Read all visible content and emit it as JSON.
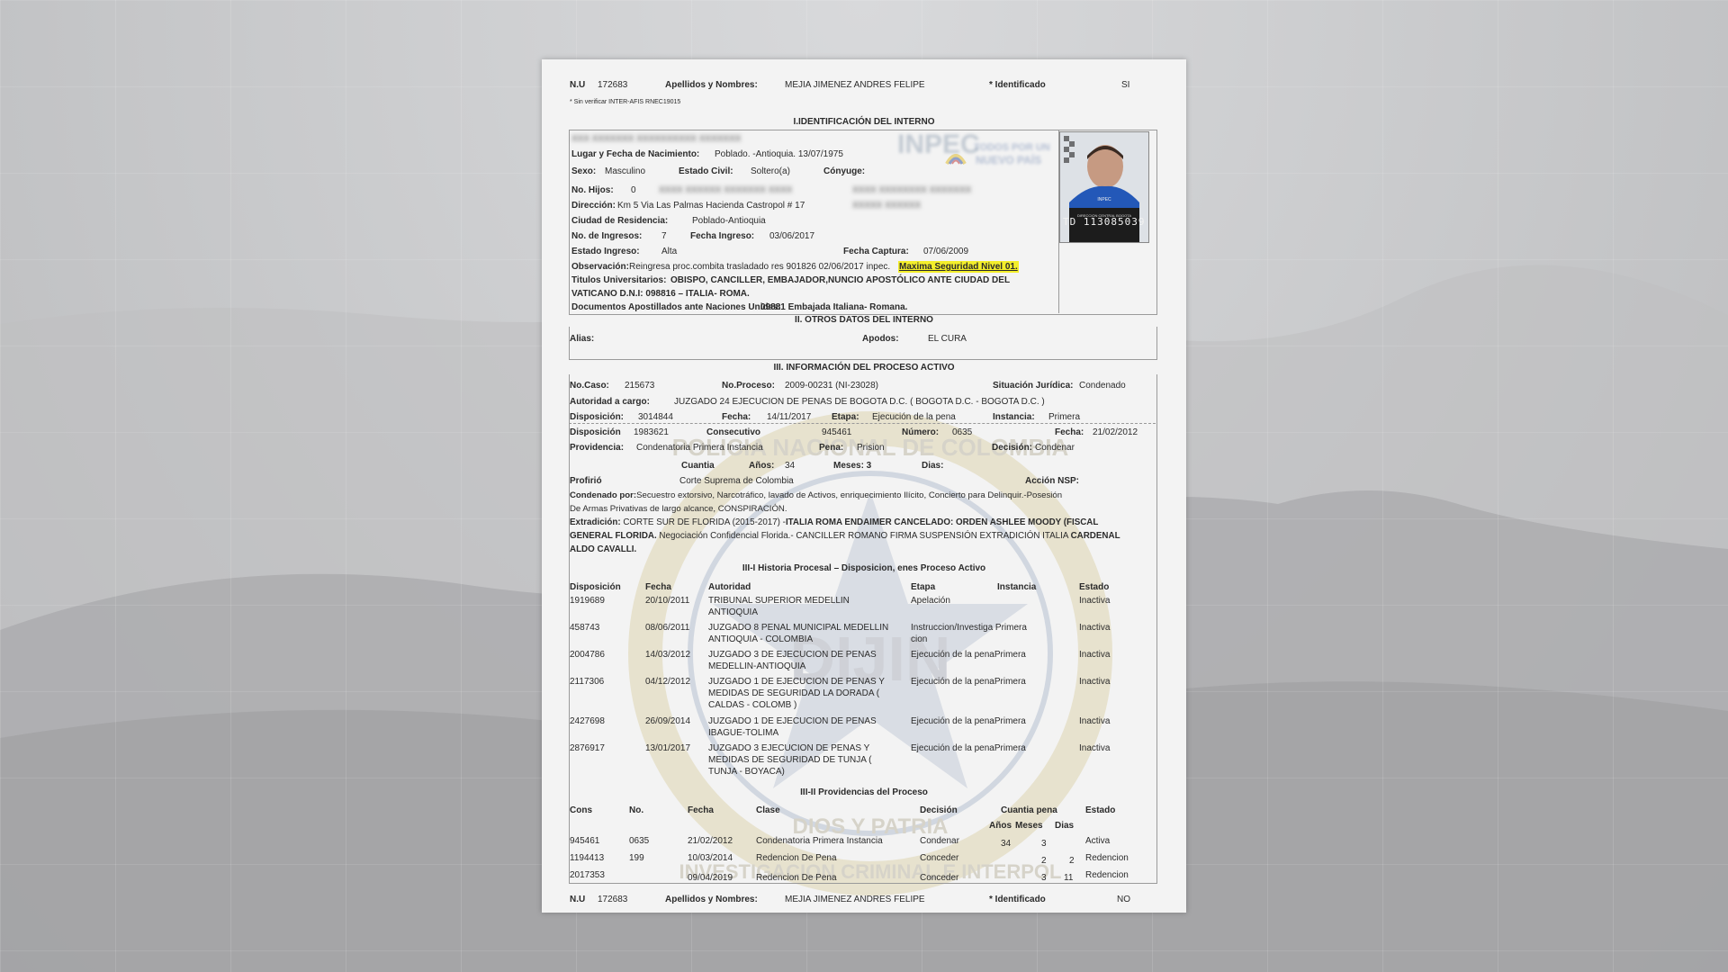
{
  "header": {
    "nu_label": "N.U",
    "nu_value": "172683",
    "nombres_label": "Apellidos y Nombres:",
    "nombres_value": "MEJIA JIMENEZ ANDRES FELIPE",
    "identificado_label": "* Identificado",
    "identificado_value": "SI",
    "note": "* Sin verificar INTER-AFIS RNEC19015"
  },
  "section1": {
    "title": "I.IDENTIFICACIÓN DEL INTERNO",
    "nacimiento_label": "Lugar y Fecha de Nacimiento:",
    "nacimiento_value": "Poblado. -Antioquia. 13/07/1975",
    "sexo_label": "Sexo:",
    "sexo_value": "Masculino",
    "estado_civil_label": "Estado Civil:",
    "estado_civil_value": "Soltero(a)",
    "conyuge_label": "Cónyuge:",
    "hijos_label": "No. Hijos:",
    "hijos_value": "0",
    "direccion_label": "Dirección:",
    "direccion_value": "Km 5 Via Las Palmas Hacienda Castropol # 17",
    "ciudad_label": "Ciudad de Residencia:",
    "ciudad_value": "Poblado-Antioquia",
    "ingresos_label": "No. de Ingresos:",
    "ingresos_value": "7",
    "fecha_ingreso_label": "Fecha Ingreso:",
    "fecha_ingreso_value": "03/06/2017",
    "estado_ingreso_label": "Estado Ingreso:",
    "estado_ingreso_value": "Alta",
    "fecha_captura_label": "Fecha Captura:",
    "fecha_captura_value": "07/06/2009",
    "observacion_label": "Observación:",
    "observacion_value": "Reingresa proc.combita trasladado res 901826 02/06/2017 inpec.",
    "observacion_highlight": "Maxima Seguridad Nivel 01.",
    "titulos_label": "Titulos Universitarios:",
    "titulos_value_1": "OBISPO, CANCILLER, EMBAJADOR,NUNCIO APOSTÓLICO ANTE CIUDAD DEL",
    "titulos_value_2": "VATICANO D.N.I: 098816 – ITALIA- ROMA.",
    "documentos_label": "Documentos Apostillados ante Naciones Unidas:",
    "documentos_value": "09881 Embajada Italiana- Romana.",
    "logo_text_1": "TODOS POR UN",
    "logo_text_2": "NUEVO PAÍS",
    "logo_inpec": "INPEC",
    "photo_sign_1": "INPEC",
    "photo_sign_2": "DIRECCION CENTRAL BOGOTA",
    "photo_id": "TD 113085039"
  },
  "section2": {
    "title": "II. OTROS DATOS DEL INTERNO",
    "alias_label": "Alias:",
    "apodos_label": "Apodos:",
    "apodos_value": "EL CURA"
  },
  "section3": {
    "title": "III. INFORMACIÓN DEL PROCESO ACTIVO",
    "caso_label": "No.Caso:",
    "caso_value": "215673",
    "proceso_label": "No.Proceso:",
    "proceso_value": "2009-00231 (NI-23028)",
    "situacion_label": "Situación Jurídica:",
    "situacion_value": "Condenado",
    "autoridad_label": "Autoridad a cargo:",
    "autoridad_value": "JUZGADO 24 EJECUCION DE PENAS DE BOGOTA D.C. ( BOGOTA D.C. - BOGOTA D.C. )",
    "disposicion_label": "Disposición:",
    "disposicion_value": "3014844",
    "fecha_label": "Fecha:",
    "fecha_value": "14/11/2017",
    "etapa_label": "Etapa:",
    "etapa_value": "Ejecución de la pena",
    "instancia_label": "Instancia:",
    "instancia_value": "Primera",
    "disposicion2_label": "Disposición",
    "disposicion2_value": "1983621",
    "consecutivo_label": "Consecutivo",
    "consecutivo_value": "945461",
    "numero_label": "Número:",
    "numero_value": "0635",
    "fecha2_label": "Fecha:",
    "fecha2_value": "21/02/2012",
    "providencia_label": "Providencia:",
    "providencia_value": "Condenatoria Primera Instancia",
    "pena_label": "Pena:",
    "pena_value": "Prision",
    "decision_label": "Decisión:",
    "decision_value": "Condenar",
    "cuantia_label": "Cuantia",
    "anos_label": "Años:",
    "anos_value": "34",
    "meses_label": "Meses: 3",
    "dias_label": "Dias:",
    "profirio_label": "Profirió",
    "profirio_value": "Corte Suprema de Colombia",
    "accion_label": "Acción NSP:",
    "condenado_label": "Condenado por:",
    "condenado_value_1": "Secuestro extorsivo, Narcotráfico, lavado de Activos, enriquecimiento Ilícito, Concierto para Delinquir.-Posesión",
    "condenado_value_2": "De Armas Privativas de largo alcance, CONSPIRACIÓN.",
    "extradicion_label": "Extradición:",
    "extradicion_value_1": "CORTE SUR DE FLORIDA (2015-2017) -",
    "extradicion_bold_1": "ITALIA ROMA ENDAIMER CANCELADO: ORDEN  ASHLEE  MOODY (FISCAL",
    "extradicion_bold_2": "GENERAL FLORIDA.",
    "extradicion_value_2": " Negociación Confidencial Florida.-  CANCILLER ROMANO FIRMA SUSPENSIÓN EXTRADICIÓN ITALIA ",
    "extradicion_bold_3": "CARDENAL",
    "extradicion_bold_4": "ALDO CAVALLI."
  },
  "historia": {
    "title": "III-I Historia Procesal – Disposicion, enes Proceso Activo",
    "headers": [
      "Disposición",
      "Fecha",
      "Autoridad",
      "Etapa",
      "Instancia",
      "Estado"
    ],
    "rows": [
      {
        "disp": "1919689",
        "fecha": "20/10/2011",
        "aut1": "TRIBUNAL SUPERIOR MEDELLIN",
        "aut2": "ANTIOQUIA",
        "aut3": "",
        "etapa1": "Apelación",
        "etapa2": "",
        "instancia": "",
        "estado": "Inactiva"
      },
      {
        "disp": "458743",
        "fecha": "08/06/2011",
        "aut1": "JUZGADO 8 PENAL MUNICIPAL MEDELLIN",
        "aut2": "ANTIOQUIA - COLOMBIA",
        "aut3": "",
        "etapa1": "Instruccion/Investiga Primera",
        "etapa2": "cion",
        "instancia": "",
        "estado": "Inactiva"
      },
      {
        "disp": "2004786",
        "fecha": "14/03/2012",
        "aut1": "JUZGADO 3 DE EJECUCION DE PENAS",
        "aut2": "MEDELLIN-ANTIOQUIA",
        "aut3": "",
        "etapa1": "Ejecución de la penaPrimera",
        "etapa2": "",
        "instancia": "",
        "estado": "Inactiva"
      },
      {
        "disp": "2117306",
        "fecha": "04/12/2012",
        "aut1": "JUZGADO 1 DE EJECUCION DE PENAS Y",
        "aut2": "MEDIDAS DE SEGURIDAD LA  DORADA (",
        "aut3": "CALDAS - COLOMB )",
        "etapa1": "Ejecución de la penaPrimera",
        "etapa2": "",
        "instancia": "",
        "estado": "Inactiva"
      },
      {
        "disp": "2427698",
        "fecha": "26/09/2014",
        "aut1": "JUZGADO 1 DE EJECUCION DE PENAS",
        "aut2": "IBAGUE-TOLIMA",
        "aut3": "",
        "etapa1": "Ejecución de la penaPrimera",
        "etapa2": "",
        "instancia": "",
        "estado": "Inactiva"
      },
      {
        "disp": "2876917",
        "fecha": "13/01/2017",
        "aut1": "JUZGADO  3 EJECUCION DE PENAS Y",
        "aut2": "MEDIDAS DE SEGURIDAD  DE TUNJA (",
        "aut3": "TUNJA - BOYACA)",
        "etapa1": "Ejecución de la penaPrimera",
        "etapa2": "",
        "instancia": "",
        "estado": "Inactiva"
      }
    ]
  },
  "providencias": {
    "title": "III-II Providencias del Proceso",
    "headers": [
      "Cons",
      "No.",
      "Fecha",
      "Clase",
      "Decisión",
      "Cuantia pena",
      "Estado"
    ],
    "subheaders": [
      "Años",
      "Meses",
      "Dias"
    ],
    "rows": [
      {
        "cons": "945461",
        "no": "0635",
        "fecha": "21/02/2012",
        "clase": "Condenatoria Primera Instancia",
        "decision": "Condenar",
        "anos": "34",
        "meses": "3",
        "dias": "",
        "estado": "Activa"
      },
      {
        "cons": "1194413",
        "no": "199",
        "fecha": "10/03/2014",
        "clase": "Redencion De Pena",
        "decision": "Conceder",
        "anos": "",
        "meses": "2",
        "dias": "2",
        "estado": "Redencion"
      },
      {
        "cons": "2017353",
        "no": "",
        "fecha": "09/04/2019",
        "clase": "Redencion De Pena",
        "decision": "Conceder",
        "anos": "",
        "meses": "3",
        "dias": "11",
        "estado": "Redencion"
      }
    ]
  },
  "footer": {
    "nu_label": "N.U",
    "nu_value": "172683",
    "nombres_label": "Apellidos y Nombres:",
    "nombres_value": "MEJIA JIMENEZ ANDRES FELIPE",
    "identificado_label": "* Identificado",
    "identificado_value": "NO"
  },
  "watermark_text_top": "POLICIA NACIONAL DE COLOMBIA",
  "watermark_text_center": "DIJIN",
  "watermark_text_bottom": "INVESTIGACION CRIMINAL E INTERPOL",
  "watermark_text_motto": "DIOS Y PATRIA"
}
